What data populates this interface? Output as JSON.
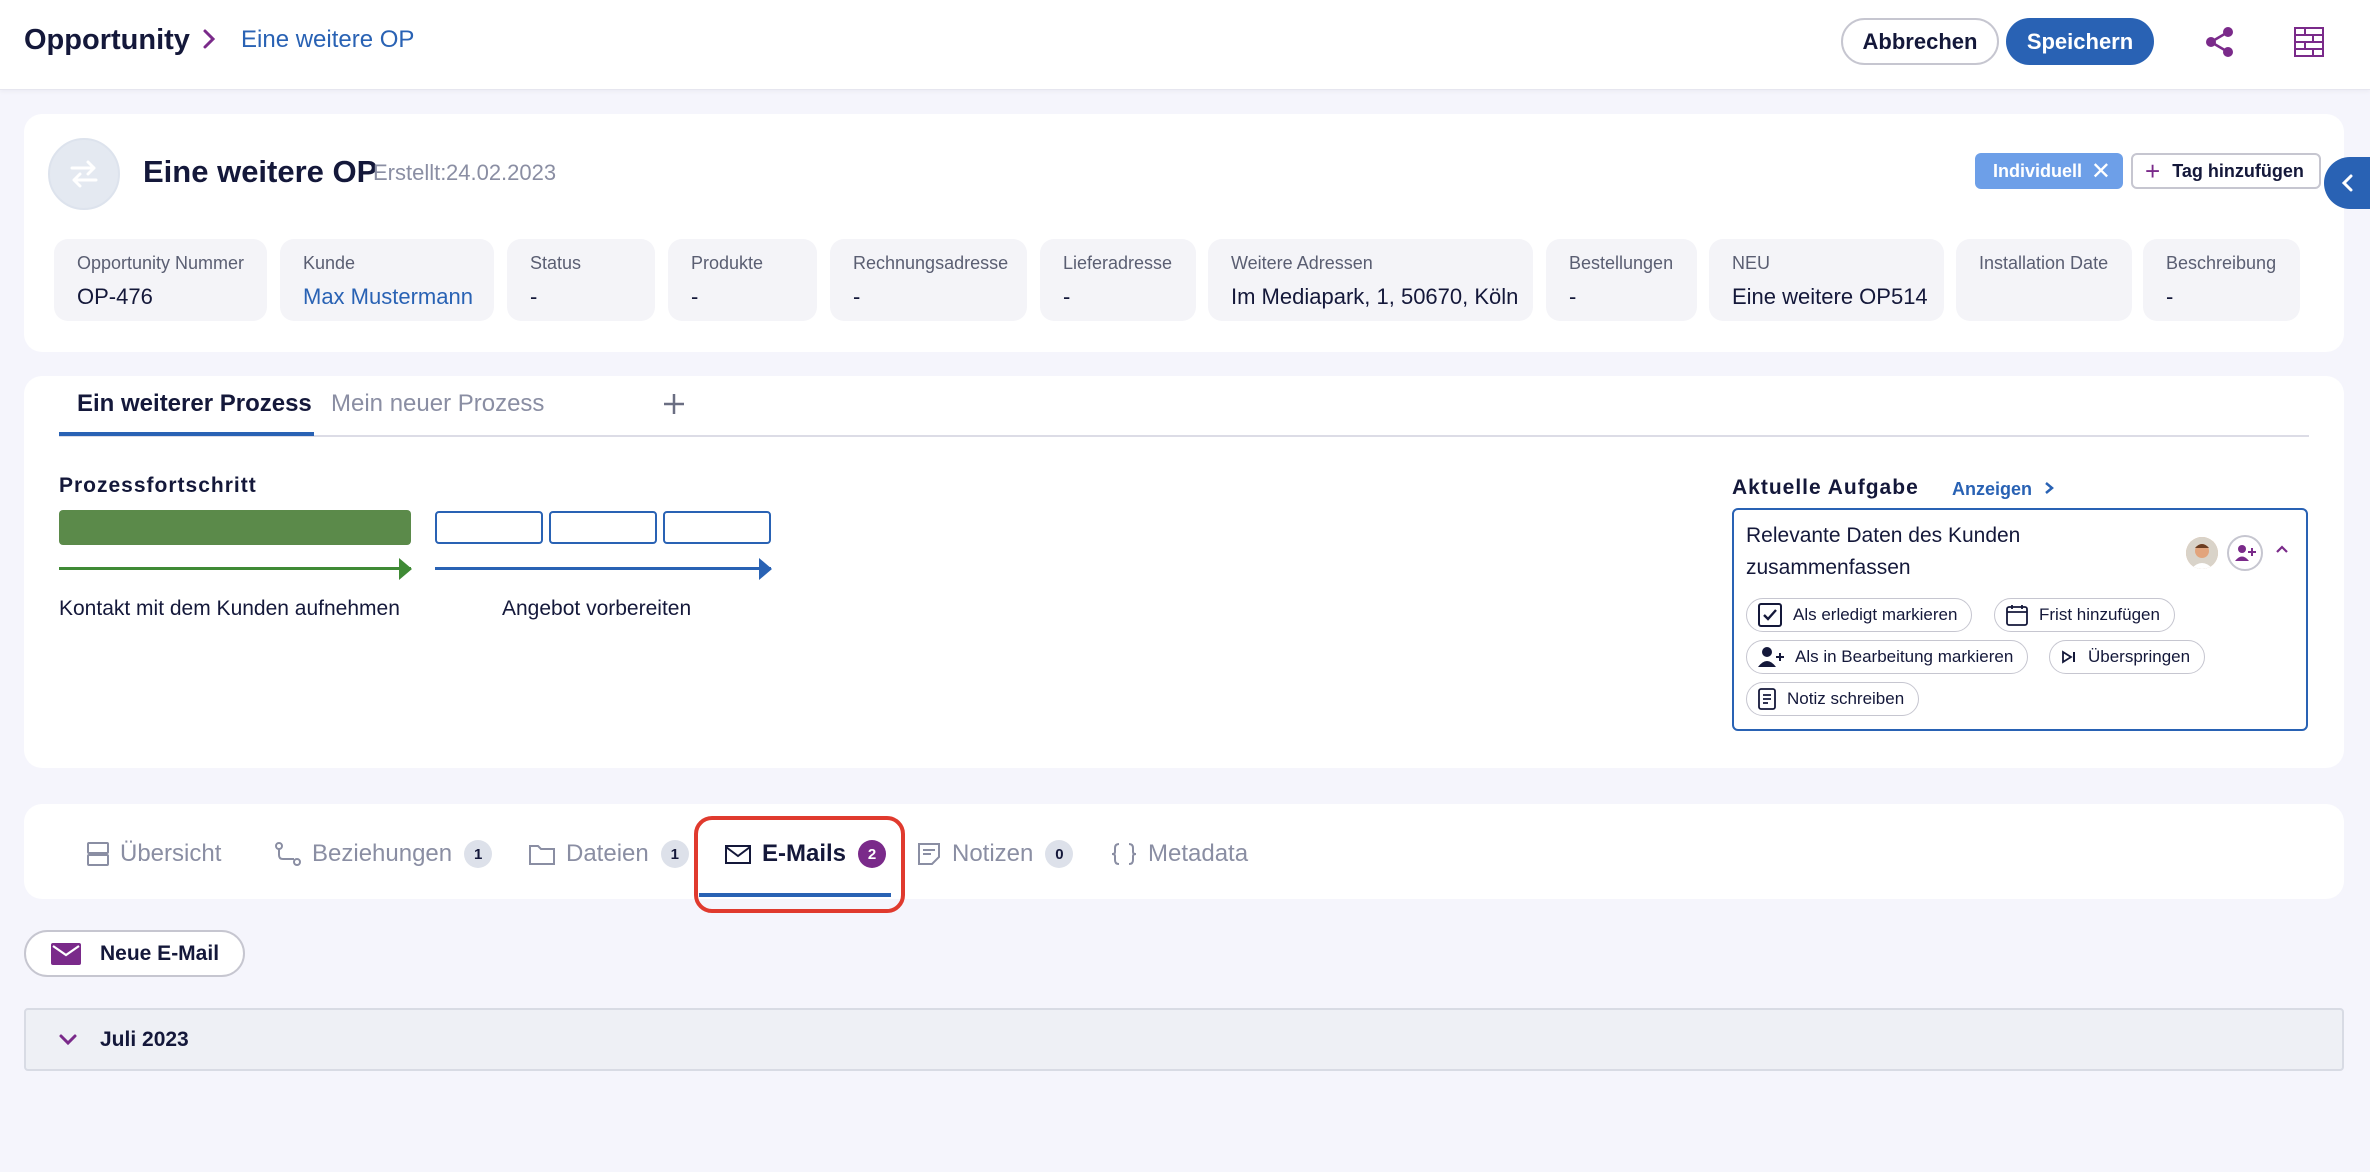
{
  "header": {
    "breadcrumb_root": "Opportunity",
    "breadcrumb_separator": ">",
    "breadcrumb_current": "Eine weitere OP",
    "cancel_label": "Abbrechen",
    "save_label": "Speichern",
    "share_icon": "share-icon",
    "layout_icon": "layout-grid-icon"
  },
  "opportunity": {
    "title": "Eine weitere OP",
    "created_label": "Erstellt:",
    "created_date": "24.02.2023",
    "tags": [
      {
        "label": "Individuell"
      }
    ],
    "add_tag_label": "Tag hinzufügen",
    "fields": [
      {
        "label": "Opportunity Nummer",
        "value": "OP-476"
      },
      {
        "label": "Kunde",
        "value": "Max Mustermann"
      },
      {
        "label": "Status",
        "value": "-"
      },
      {
        "label": "Produkte",
        "value": "-"
      },
      {
        "label": "Rechnungsadresse",
        "value": "-"
      },
      {
        "label": "Lieferadresse",
        "value": "-"
      },
      {
        "label": "Weitere Adressen",
        "value": "Im Mediapark, 1, 50670, Köln"
      },
      {
        "label": "Bestellungen",
        "value": "-"
      },
      {
        "label": "NEU",
        "value": "Eine weitere OP514"
      },
      {
        "label": "Installation Date",
        "value": ""
      },
      {
        "label": "Beschreibung",
        "value": "-"
      }
    ]
  },
  "process": {
    "tabs": [
      {
        "label": "Ein weiterer Prozess",
        "active": true
      },
      {
        "label": "Mein neuer Prozess",
        "active": false
      }
    ],
    "add_icon": "plus-icon",
    "progress_heading": "Prozessfortschritt",
    "stages": [
      {
        "name": "Kontakt mit dem Kunden aufnehmen",
        "segments_total": 1,
        "segments_done": 1,
        "color": "#5b8a4a"
      },
      {
        "name": "Angebot vorbereiten",
        "segments_total": 3,
        "segments_done": 0,
        "color": "#2962b4"
      }
    ],
    "current_task": {
      "heading": "Aktuelle Aufgabe",
      "show_label": "Anzeigen",
      "title": "Relevante Daten des Kunden zusammenfassen",
      "actions": [
        {
          "label": "Als erledigt markieren",
          "icon": "checkbox-icon"
        },
        {
          "label": "Frist hinzufügen",
          "icon": "calendar-icon"
        },
        {
          "label": "Als in Bearbeitung markieren",
          "icon": "person-add-icon"
        },
        {
          "label": "Überspringen",
          "icon": "skip-icon"
        },
        {
          "label": "Notiz schreiben",
          "icon": "note-icon"
        }
      ]
    }
  },
  "tabs": [
    {
      "label": "Übersicht",
      "icon": "overview-icon",
      "count": null
    },
    {
      "label": "Beziehungen",
      "icon": "relations-icon",
      "count": "1"
    },
    {
      "label": "Dateien",
      "icon": "folder-icon",
      "count": "1"
    },
    {
      "label": "E-Mails",
      "icon": "mail-icon",
      "count": "2",
      "active": true
    },
    {
      "label": "Notizen",
      "icon": "notes-icon",
      "count": "0"
    },
    {
      "label": "Metadata",
      "icon": "braces-icon",
      "count": null
    }
  ],
  "emails": {
    "new_mail_label": "Neue E-Mail",
    "groups": [
      {
        "label": "Juli 2023",
        "expanded": false
      }
    ]
  },
  "colors": {
    "primary": "#2962b4",
    "accent": "#7a2a8a",
    "done": "#5b8a4a",
    "highlight": "#e03a2e"
  }
}
